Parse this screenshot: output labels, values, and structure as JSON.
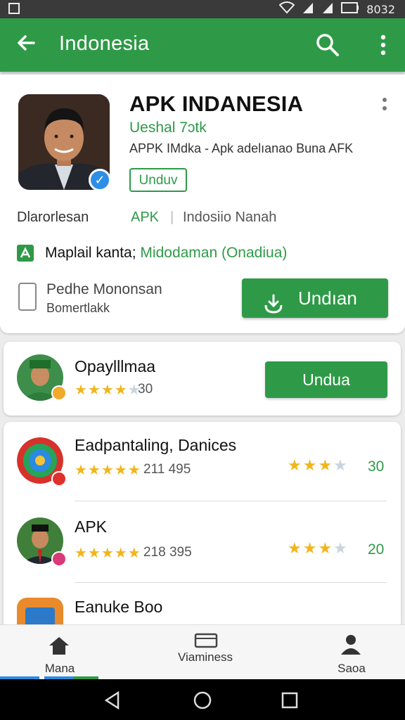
{
  "status_bar": {
    "time": "8032"
  },
  "toolbar": {
    "title": "Indonesia"
  },
  "app": {
    "title": "APK INDANESIA",
    "developer": "Ueshal 7ɔtk",
    "subtitle": "APPK IMdka - Apk adelıanao Buna AFK",
    "install_outline_label": "Unduv",
    "meta_left": "Dlarorlesan",
    "meta_middle": "APK",
    "meta_separator": "|",
    "meta_right": "Indosiio Nanah",
    "info_text_a": "Maplail kanta;",
    "info_text_b": "Midodaman (Onadiua)",
    "device_line1": "Pedhe Mononsan",
    "device_line2": "Bomertlakk",
    "install_button_label": "Undıan"
  },
  "featured": {
    "title": "Opaylllmaa",
    "rating_count": "30",
    "button_label": "Undua"
  },
  "list": [
    {
      "title": "Eadpantaling, Danices",
      "rating_count": "211 495",
      "right_value": "30"
    },
    {
      "title": "APK",
      "rating_count": "218 395",
      "right_value": "20"
    },
    {
      "title": "Eanuke Boo"
    }
  ],
  "bottom_nav": [
    {
      "label": "Mana",
      "icon": "home-icon"
    },
    {
      "label": "Viaminess",
      "icon": "window-icon"
    },
    {
      "label": "Saoa",
      "icon": "person-icon"
    }
  ],
  "colors": {
    "accent": "#2e9a47",
    "star": "#f2b51b",
    "verify": "#2d8ee6"
  }
}
